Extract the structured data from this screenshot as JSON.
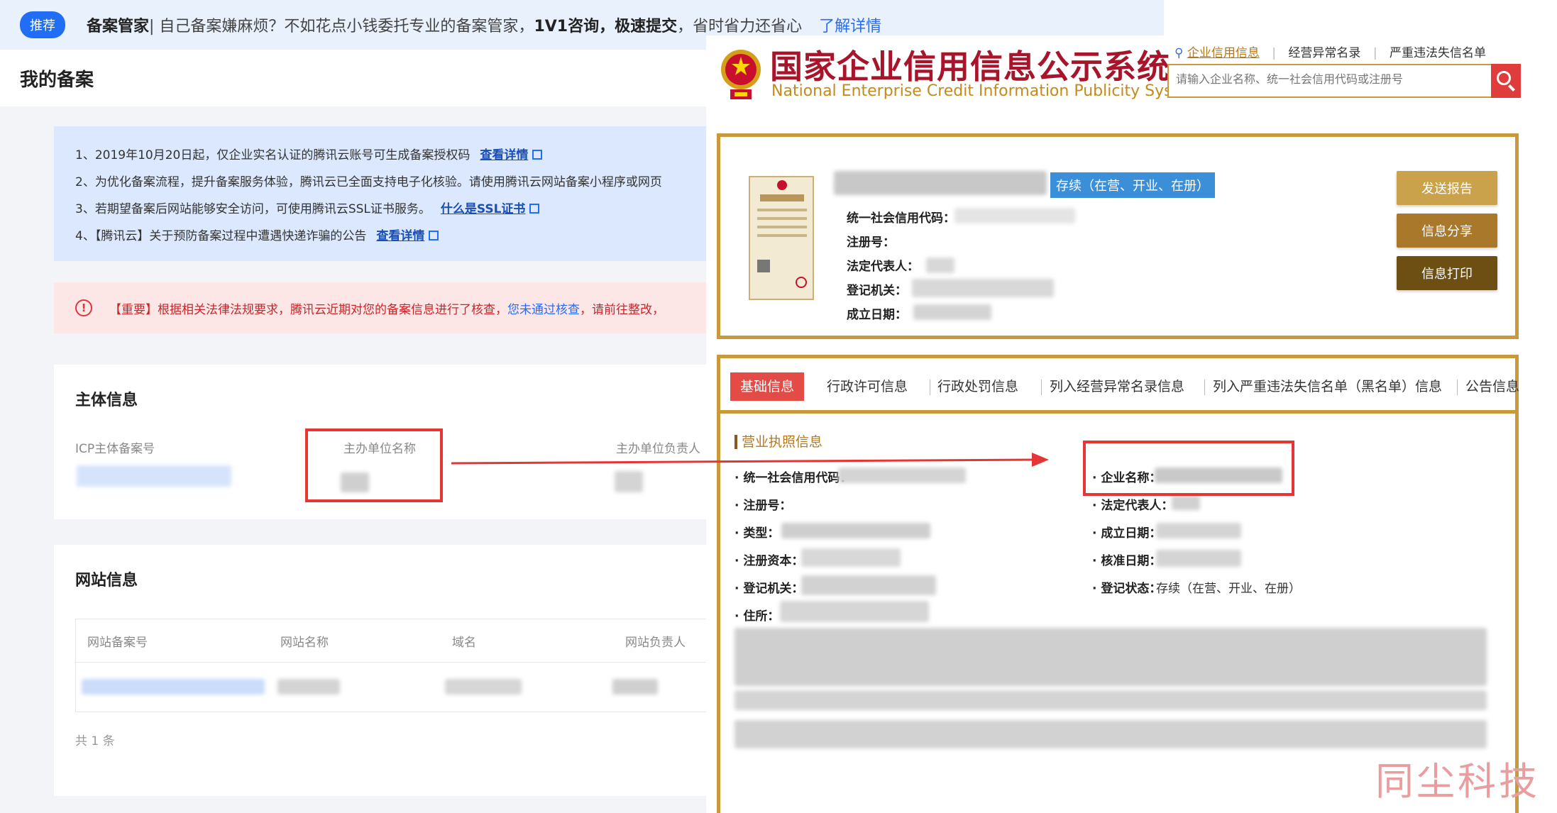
{
  "promo": {
    "tag": "推荐",
    "title": "备案管家",
    "text1": "| 自己备案嫌麻烦？不如花点小钱委托专业的备案管家，",
    "bold1": "1V1咨询，",
    "bold2": "极速提交",
    "text2": "，省时省力还省心",
    "link": "了解详情"
  },
  "page_title": "我的备案",
  "notices": [
    {
      "text": "1、2019年10月20日起，仅企业实名认证的腾讯云账号可生成备案授权码",
      "link": "查看详情"
    },
    {
      "text": "2、为优化备案流程，提升备案服务体验，腾讯云已全面支持电子化核验。请使用腾讯云网站备案小程序或网页",
      "link": ""
    },
    {
      "text": "3、若期望备案后网站能够安全访问，可使用腾讯云SSL证书服务。",
      "link": "什么是SSL证书"
    },
    {
      "text": "4、【腾讯云】关于预防备案过程中遭遇快递诈骗的公告",
      "link": "查看详情"
    }
  ],
  "alert": {
    "text": "【重要】根据相关法律法规要求，腾讯云近期对您的备案信息进行了核查，",
    "link": "您未通过核查",
    "text2": "，请前往整改，"
  },
  "subject_card": {
    "title": "主体信息",
    "icp_label": "ICP主体备案号",
    "org_label": "主办单位名称",
    "owner_label": "主办单位负责人"
  },
  "site_card": {
    "title": "网站信息",
    "columns": [
      "网站备案号",
      "网站名称",
      "域名",
      "网站负责人"
    ],
    "total": "共 1 条"
  },
  "gsxt": {
    "title_cn": "国家企业信用信息公示系统",
    "title_en": "National Enterprise Credit Information Publicity System",
    "top_links": [
      "企业信用信息",
      "经营异常名录",
      "严重违法失信名单"
    ],
    "search_placeholder": "请输入企业名称、统一社会信用代码或注册号",
    "status_badge": "存续（在营、开业、在册）",
    "summary_labels": [
      "统一社会信用代码：",
      "注册号：",
      "法定代表人：",
      "登记机关：",
      "成立日期："
    ],
    "buttons": [
      "发送报告",
      "信息分享",
      "信息打印"
    ],
    "tabs": [
      "基础信息",
      "行政许可信息",
      "行政处罚信息",
      "列入经营异常名录信息",
      "列入严重违法失信名单（黑名单）信息",
      "公告信息"
    ],
    "section_title": "营业执照信息",
    "left_labels": [
      "· 统一社会信用代码：",
      "· 注册号：",
      "· 类型：",
      "· 注册资本：",
      "· 登记机关：",
      "· 住所："
    ],
    "right_labels": [
      "· 企业名称：",
      "· 法定代表人：",
      "· 成立日期：",
      "· 核准日期：",
      "· 登记状态："
    ],
    "status_value": "存续（在营、开业、在册）"
  },
  "watermark": "同尘科技",
  "colors": {
    "highlight": "#e53535",
    "gold": "#c89a3c",
    "tencent_blue": "#1f6ef5",
    "gsxt_red": "#a8152a"
  }
}
